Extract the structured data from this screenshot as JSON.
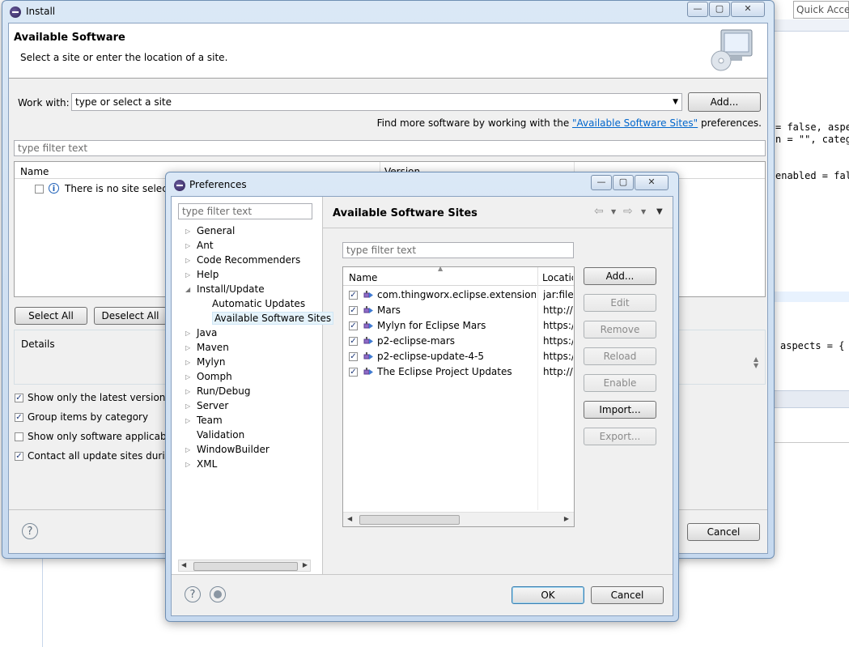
{
  "editor": {
    "quick_access": "Quick Access",
    "code_lines": [
      "= false, aspe",
      "n = \"\", categ",
      "enabled = fal",
      "aspects = {"
    ]
  },
  "install": {
    "title": "Install",
    "header_title": "Available Software",
    "header_subtitle": "Select a site or enter the location of a site.",
    "work_with_label": "Work with:",
    "work_with_placeholder": "type or select a site",
    "add_button": "Add...",
    "find_more_prefix": "Find more software by working with the ",
    "find_more_link": "\"Available Software Sites\"",
    "find_more_suffix": " preferences.",
    "filter_placeholder": "type filter text",
    "col_name": "Name",
    "col_version": "Version",
    "no_site": "There is no site selected",
    "select_all": "Select All",
    "deselect_all": "Deselect All",
    "details_label": "Details",
    "options": [
      {
        "label": "Show only the latest versions of a",
        "checked": true
      },
      {
        "label": "Group items by category",
        "checked": true
      },
      {
        "label": "Show only software applicable to",
        "checked": false
      },
      {
        "label": "Contact all update sites during in",
        "checked": true
      }
    ],
    "cancel_button": "Cancel"
  },
  "prefs": {
    "title": "Preferences",
    "filter_placeholder": "type filter text",
    "page_title": "Available Software Sites",
    "tree": [
      {
        "label": "General",
        "expandable": true,
        "indent": 0
      },
      {
        "label": "Ant",
        "expandable": true,
        "indent": 0
      },
      {
        "label": "Code Recommenders",
        "expandable": true,
        "indent": 0
      },
      {
        "label": "Help",
        "expandable": true,
        "indent": 0
      },
      {
        "label": "Install/Update",
        "expandable": true,
        "expanded": true,
        "indent": 0
      },
      {
        "label": "Automatic Updates",
        "expandable": false,
        "indent": 1
      },
      {
        "label": "Available Software Sites",
        "expandable": false,
        "indent": 1,
        "selected": true
      },
      {
        "label": "Java",
        "expandable": true,
        "indent": 0
      },
      {
        "label": "Maven",
        "expandable": true,
        "indent": 0
      },
      {
        "label": "Mylyn",
        "expandable": true,
        "indent": 0
      },
      {
        "label": "Oomph",
        "expandable": true,
        "indent": 0
      },
      {
        "label": "Run/Debug",
        "expandable": true,
        "indent": 0
      },
      {
        "label": "Server",
        "expandable": true,
        "indent": 0
      },
      {
        "label": "Team",
        "expandable": true,
        "indent": 0
      },
      {
        "label": "Validation",
        "expandable": false,
        "indent": 0
      },
      {
        "label": "WindowBuilder",
        "expandable": true,
        "indent": 0
      },
      {
        "label": "XML",
        "expandable": true,
        "indent": 0
      }
    ],
    "sites_filter_placeholder": "type filter text",
    "col_name": "Name",
    "col_location": "Locatic",
    "sites": [
      {
        "name": "com.thingworx.eclipse.extension.u...",
        "location": "jar:file:/",
        "checked": true
      },
      {
        "name": "Mars",
        "location": "http://",
        "checked": true
      },
      {
        "name": "Mylyn for Eclipse Mars",
        "location": "https:/",
        "checked": true
      },
      {
        "name": "p2-eclipse-mars",
        "location": "https:/",
        "checked": true
      },
      {
        "name": "p2-eclipse-update-4-5",
        "location": "https:/",
        "checked": true
      },
      {
        "name": "The Eclipse Project Updates",
        "location": "http://",
        "checked": true
      }
    ],
    "buttons": {
      "add": "Add...",
      "edit": "Edit",
      "remove": "Remove",
      "reload": "Reload",
      "enable": "Enable",
      "import": "Import...",
      "export": "Export..."
    },
    "ok_button": "OK",
    "cancel_button": "Cancel"
  }
}
